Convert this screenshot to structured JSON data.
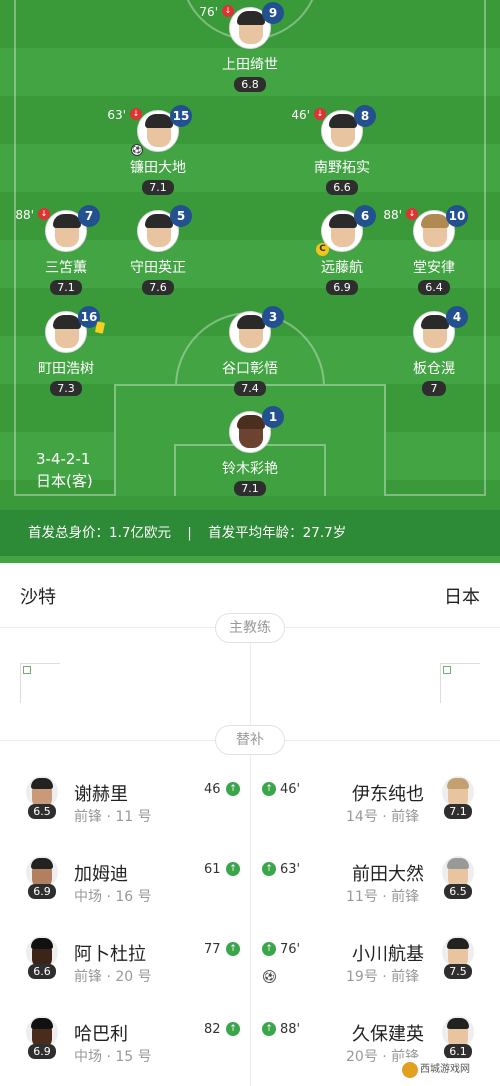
{
  "lineup": {
    "formation": "3-4-2-1",
    "team_label": "日本(客)",
    "players": [
      {
        "name": "上田绮世",
        "number": "9",
        "rating": "6.8",
        "sub_time": "76'",
        "sub_icon": true
      },
      {
        "name": "镰田大地",
        "number": "15",
        "rating": "7.1",
        "sub_time": "63'",
        "sub_icon": true,
        "goal": true
      },
      {
        "name": "南野拓实",
        "number": "8",
        "rating": "6.6",
        "sub_time": "46'",
        "sub_icon": true
      },
      {
        "name": "三笘薫",
        "number": "7",
        "rating": "7.1",
        "sub_time": "88'",
        "sub_icon": true
      },
      {
        "name": "守田英正",
        "number": "5",
        "rating": "7.6"
      },
      {
        "name": "远藤航",
        "number": "6",
        "rating": "6.9",
        "captain": true
      },
      {
        "name": "堂安律",
        "number": "10",
        "rating": "6.4",
        "sub_time": "88'",
        "sub_icon": true
      },
      {
        "name": "町田浩树",
        "number": "16",
        "rating": "7.3",
        "yellow_card": true
      },
      {
        "name": "谷口彰悟",
        "number": "3",
        "rating": "7.4"
      },
      {
        "name": "板仓滉",
        "number": "4",
        "rating": "7"
      },
      {
        "name": "铃木彩艳",
        "number": "1",
        "rating": "7.1"
      }
    ],
    "value_text": "首发总身价：1.7亿欧元",
    "separator": "|",
    "age_text": "首发平均年龄：27.7岁"
  },
  "teams": {
    "home": "沙特",
    "away": "日本"
  },
  "sections": {
    "coach": "主教练",
    "subs": "替补"
  },
  "substitutes": [
    {
      "left": {
        "name": "谢赫里",
        "meta": "前锋 · 11 号",
        "rating": "6.5",
        "time": "46"
      },
      "right": {
        "name": "伊东纯也",
        "meta": "14号 · 前锋",
        "rating": "7.1",
        "time": "46'"
      }
    },
    {
      "left": {
        "name": "加姆迪",
        "meta": "中场 · 16 号",
        "rating": "6.9",
        "time": "61"
      },
      "right": {
        "name": "前田大然",
        "meta": "11号 · 前锋",
        "rating": "6.5",
        "time": "63'"
      }
    },
    {
      "left": {
        "name": "阿卜杜拉",
        "meta": "前锋 · 20 号",
        "rating": "6.6",
        "time": "77"
      },
      "right": {
        "name": "小川航基",
        "meta": "19号 · 前锋",
        "rating": "7.5",
        "time": "76'",
        "goal": true
      }
    },
    {
      "left": {
        "name": "哈巴利",
        "meta": "中场 · 15 号",
        "rating": "6.9",
        "time": "82"
      },
      "right": {
        "name": "久保建英",
        "meta": "20号 · 前锋",
        "rating": "6.1",
        "time": "88'"
      }
    }
  ],
  "watermark": "西城游戏网"
}
